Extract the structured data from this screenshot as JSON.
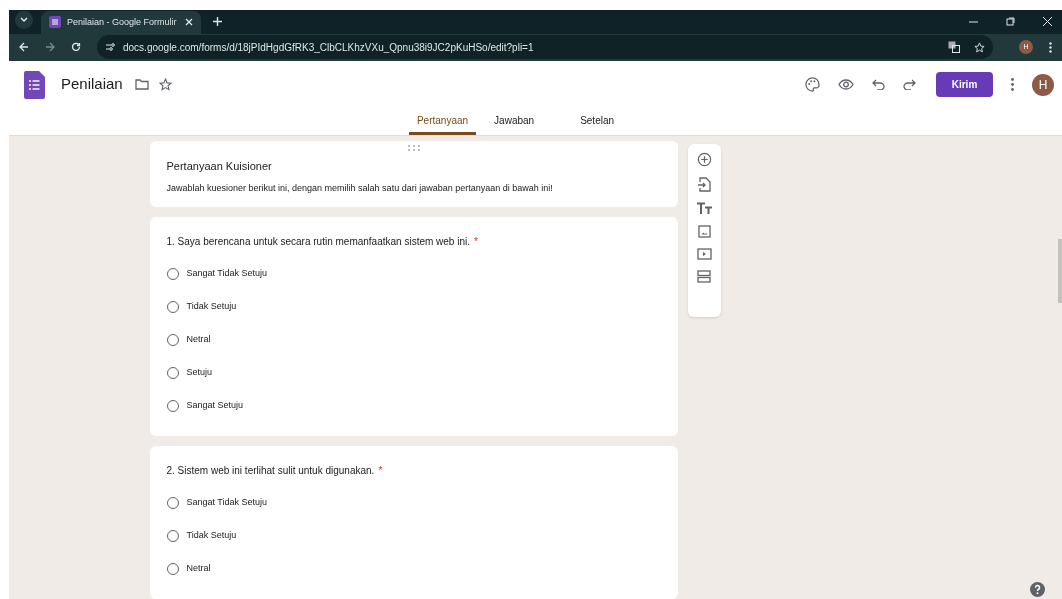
{
  "browser": {
    "tab_title": "Penilaian - Google Formulir",
    "url": "docs.google.com/forms/d/18jPIdHgdGfRK3_ClbCLKhzVXu_Qpnu38i9JC2pKuHSo/edit?pli=1",
    "profile_initial": "H"
  },
  "header": {
    "title": "Penilaian",
    "send_button": "Kirim",
    "avatar_initial": "H"
  },
  "tabs": [
    {
      "label": "Pertanyaan",
      "selected": true
    },
    {
      "label": "Jawaban",
      "selected": false
    },
    {
      "label": "Setelan",
      "selected": false
    }
  ],
  "form": {
    "title": "Pertanyaan Kuisioner",
    "description": "Jawablah kuesioner berikut ini, dengan memilih salah satu dari jawaban pertanyaan di bawah ini!"
  },
  "questions": [
    {
      "text": "1. Saya berencana untuk secara rutin memanfaatkan sistem web ini.",
      "required_mark": "*",
      "options": [
        {
          "label": "Sangat Tidak Setuju",
          "selected": false
        },
        {
          "label": "Tidak Setuju",
          "selected": false
        },
        {
          "label": "Netral",
          "selected": false
        },
        {
          "label": "Setuju",
          "selected": false
        },
        {
          "label": "Sangat Setuju",
          "selected": false
        }
      ]
    },
    {
      "text": "2. Sistem web ini terlihat sulit untuk digunakan.",
      "required_mark": "*",
      "options": [
        {
          "label": "Sangat Tidak Setuju",
          "selected": false
        },
        {
          "label": "Tidak Setuju",
          "selected": false
        },
        {
          "label": "Netral",
          "selected": false
        }
      ]
    }
  ]
}
